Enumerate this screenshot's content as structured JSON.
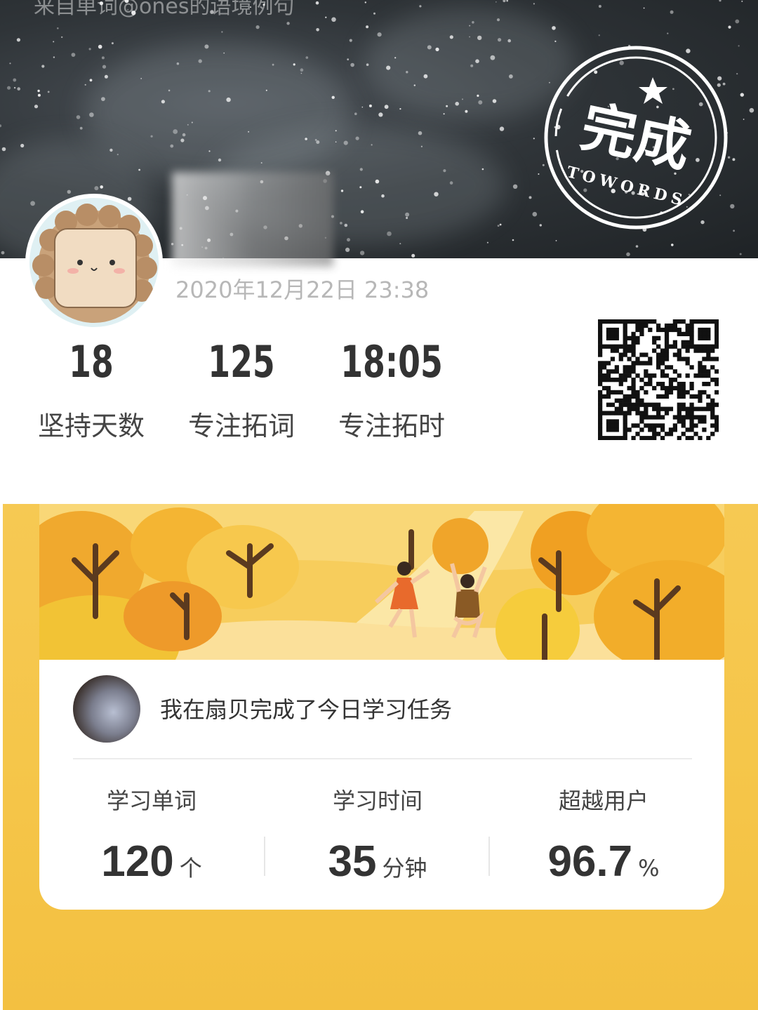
{
  "towords": {
    "caption": "来自单词@ones的语境例句",
    "stamp": {
      "main": "完成",
      "sub": "TOWORDS"
    },
    "date": "2020年12月22日 23:38",
    "stats": [
      {
        "value": "18",
        "label": "坚持天数"
      },
      {
        "value": "125",
        "label": "专注拓词"
      },
      {
        "value": "18:05",
        "label": "专注拓时"
      }
    ]
  },
  "shanbay": {
    "message": "我在扇贝完成了今日学习任务",
    "stats": [
      {
        "label": "学习单词",
        "value": "120",
        "unit": "个"
      },
      {
        "label": "学习时间",
        "value": "35",
        "unit": "分钟"
      },
      {
        "label": "超越用户",
        "value": "96.7",
        "unit": "%"
      }
    ]
  },
  "colors": {
    "accent_yellow": "#f5c548",
    "stamp_white": "#ffffff",
    "text_dark": "#333333",
    "date_gray": "#b7b7b7"
  },
  "icons": [
    "completion-stamp-icon",
    "star-icon",
    "lion-avatar",
    "qr-code",
    "autumn-scene-illustration"
  ]
}
